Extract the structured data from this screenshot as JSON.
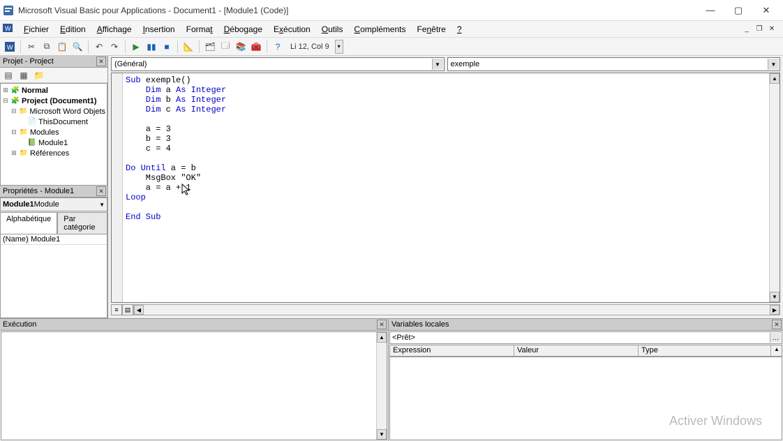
{
  "titlebar": {
    "text": "Microsoft Visual Basic pour Applications - Document1 - [Module1 (Code)]"
  },
  "menu": {
    "items": [
      "Fichier",
      "Edition",
      "Affichage",
      "Insertion",
      "Format",
      "Débogage",
      "Exécution",
      "Outils",
      "Compléments",
      "Fenêtre",
      "?"
    ]
  },
  "toolbar": {
    "status": "Li 12, Col 9"
  },
  "project": {
    "title": "Projet - Project",
    "root1": "Normal",
    "root2": "Project (Document1)",
    "folder_word": "Microsoft Word Objets",
    "thisdoc": "ThisDocument",
    "folder_modules": "Modules",
    "module1": "Module1",
    "refs": "Références"
  },
  "props": {
    "title": "Propriétés - Module1",
    "select_bold": "Module1",
    "select_rest": " Module",
    "tab_alpha": "Alphabétique",
    "tab_cat": "Par catégorie",
    "name_key": "(Name)",
    "name_val": "Module1"
  },
  "combos": {
    "left": "(Général)",
    "right": "exemple"
  },
  "code": {
    "l1a": "Sub",
    "l1b": " exemple()",
    "l2a": "    Dim",
    "l2b": " a ",
    "l2c": "As Integer",
    "l3a": "    Dim",
    "l3b": " b ",
    "l3c": "As Integer",
    "l4a": "    Dim",
    "l4b": " c ",
    "l4c": "As Integer",
    "l6": "    a = 3",
    "l7": "    b = 3",
    "l8": "    c = 4",
    "l10a": "Do Until",
    "l10b": " a = b",
    "l11": "    MsgBox \"OK\"",
    "l12": "    a = a + 1",
    "l13": "Loop",
    "l15": "End Sub"
  },
  "exec": {
    "title": "Exécution"
  },
  "vars": {
    "title": "Variables locales",
    "ready": "<Prêt>",
    "col_expr": "Expression",
    "col_val": "Valeur",
    "col_type": "Type"
  },
  "watermark": "Activer Windows"
}
